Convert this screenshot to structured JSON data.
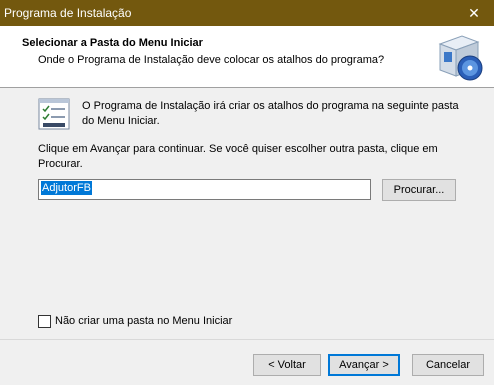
{
  "window": {
    "title": "Programa de Instalação",
    "close_glyph": "✕"
  },
  "header": {
    "title": "Selecionar a Pasta do Menu Iniciar",
    "subtitle": "Onde o Programa de Instalação deve colocar os atalhos do programa?",
    "icon": "setup-box-cd-icon"
  },
  "main": {
    "icon": "program-shortcuts-icon",
    "intro": "O Programa de Instalação irá criar os atalhos do programa na seguinte pasta do Menu Iniciar.",
    "instructions": "Clique em Avançar para continuar. Se você quiser escolher outra pasta, clique em Procurar.",
    "folder_value": "AdjutorFB",
    "browse_label": "Procurar...",
    "no_folder_label": "Não criar uma pasta no Menu Iniciar",
    "no_folder_checked": false
  },
  "footer": {
    "back_label": "< Voltar",
    "next_label": "Avançar >",
    "cancel_label": "Cancelar"
  },
  "colors": {
    "titlebar": "#73580e",
    "selection": "#0078d7",
    "default_button_border": "#0078d7"
  }
}
